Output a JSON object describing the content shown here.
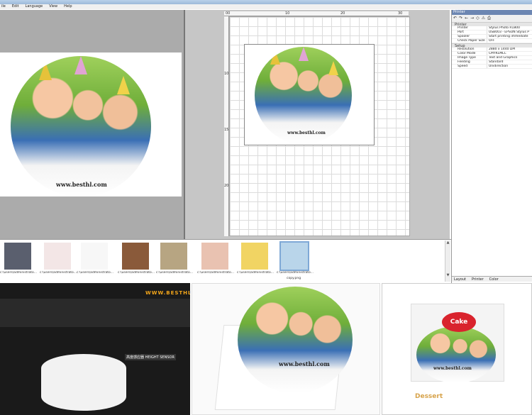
{
  "menu": {
    "items": [
      "ile",
      "Edit",
      "Language",
      "View",
      "Help"
    ]
  },
  "ruler": {
    "top": [
      "00",
      "10",
      "20",
      "30"
    ],
    "left": [
      "10",
      "15",
      "20"
    ]
  },
  "brand": {
    "url": "www.besthl.com",
    "watermark": "WWW.BESTHL.COM"
  },
  "properties": {
    "title": "Printer",
    "tools": [
      "↶",
      "↷",
      "←",
      "→",
      "◇",
      "⚠",
      "⎙"
    ],
    "sections": [
      {
        "name": "Printer",
        "rows": [
          {
            "k": "Printer",
            "v": "Stylus Photo R1800"
          },
          {
            "k": "Port",
            "v": "USB003 - EPSON Stylus P"
          },
          {
            "k": "Spooler",
            "v": "Start printing immediate"
          },
          {
            "k": "Check Paper Size",
            "v": "OFF"
          }
        ]
      },
      {
        "name": "Setup",
        "rows": [
          {
            "k": "Resolution",
            "v": "2880 x 1440 DPI"
          },
          {
            "k": "Color Mode",
            "v": "CMYKLMLC"
          },
          {
            "k": "Image Type",
            "v": "Text and Graphics"
          },
          {
            "k": "Feeding",
            "v": "Standard"
          },
          {
            "k": "Speed",
            "v": "Unidirection"
          }
        ]
      }
    ],
    "tabs": [
      "Layout",
      "Printer",
      "Color"
    ]
  },
  "thumbs": [
    {
      "caption": "c:\\users\\administrato...",
      "color": "#5a5f6e"
    },
    {
      "caption": "c:\\users\\administrato...",
      "color": "#f3e6e6"
    },
    {
      "caption": "c:\\users\\administrato...",
      "color": "#f7f7f7"
    },
    {
      "caption": "c:\\users\\administrato...",
      "color": "#8a5a3a"
    },
    {
      "caption": "c:\\users\\administrato...",
      "color": "#b7a582"
    },
    {
      "caption": "c:\\users\\administrato...",
      "color": "#e9c2b1"
    },
    {
      "caption": "c:\\users\\administrato...",
      "color": "#f1d463"
    },
    {
      "caption": "c:\\users\\administrato...",
      "color": "#b9d5ea"
    }
  ],
  "selected_thumb_caption": "copy.png",
  "photo_labels": {
    "sensor": "高度感应器 HEIGHT SENSOR",
    "cake_box": "Cake",
    "cake_sub": "Dessert"
  }
}
